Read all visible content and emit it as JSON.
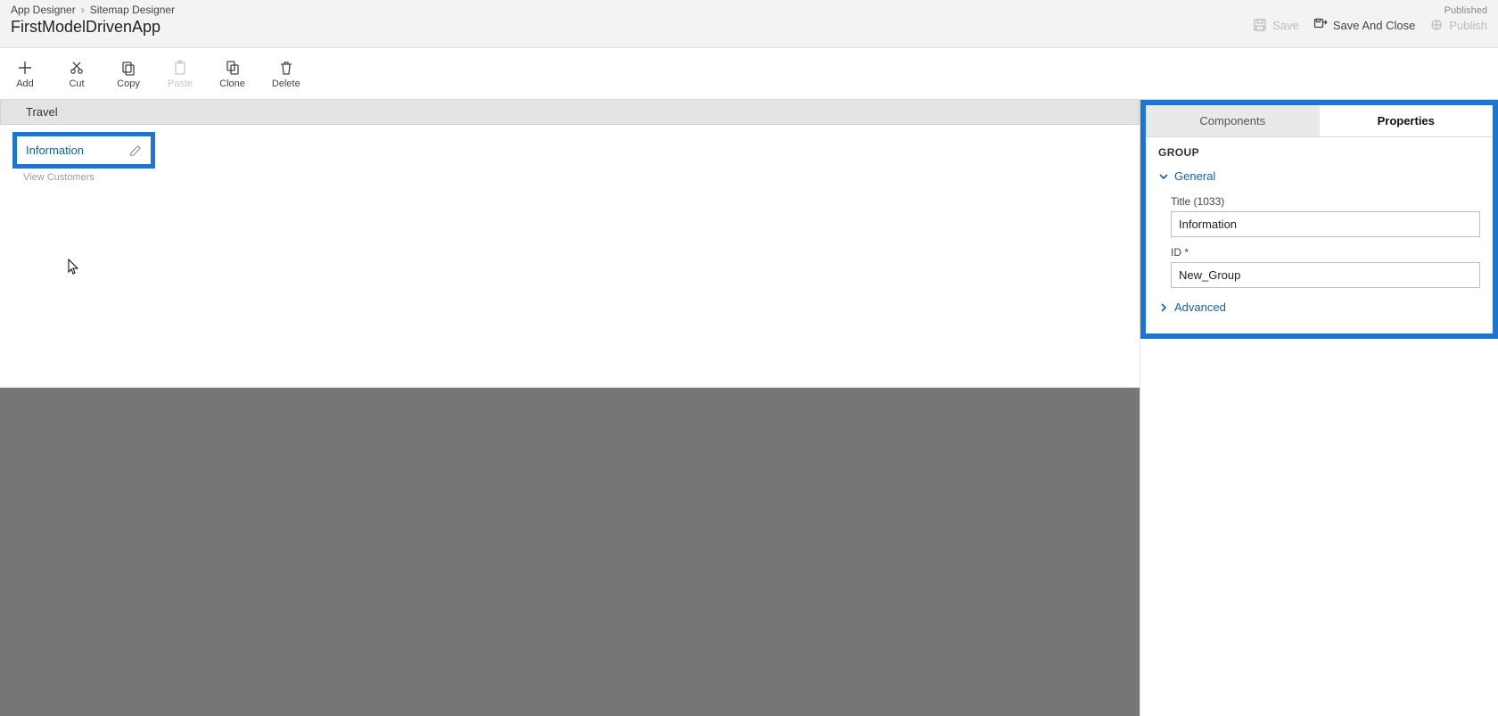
{
  "breadcrumb": {
    "items": [
      "App Designer",
      "Sitemap Designer"
    ]
  },
  "app_title": "FirstModelDrivenApp",
  "header": {
    "status": "Published",
    "save_label": "Save",
    "save_close_label": "Save And Close",
    "publish_label": "Publish"
  },
  "toolbar": {
    "add": "Add",
    "cut": "Cut",
    "copy": "Copy",
    "paste": "Paste",
    "clone": "Clone",
    "delete": "Delete"
  },
  "canvas": {
    "area_title": "Travel",
    "group_label": "Information",
    "subarea_label": "View Customers"
  },
  "panel": {
    "tabs": {
      "components": "Components",
      "properties": "Properties"
    },
    "selection_type": "GROUP",
    "sections": {
      "general": "General",
      "advanced": "Advanced"
    },
    "fields": {
      "title_label": "Title (1033)",
      "title_value": "Information",
      "id_label": "ID *",
      "id_value": "New_Group"
    }
  }
}
